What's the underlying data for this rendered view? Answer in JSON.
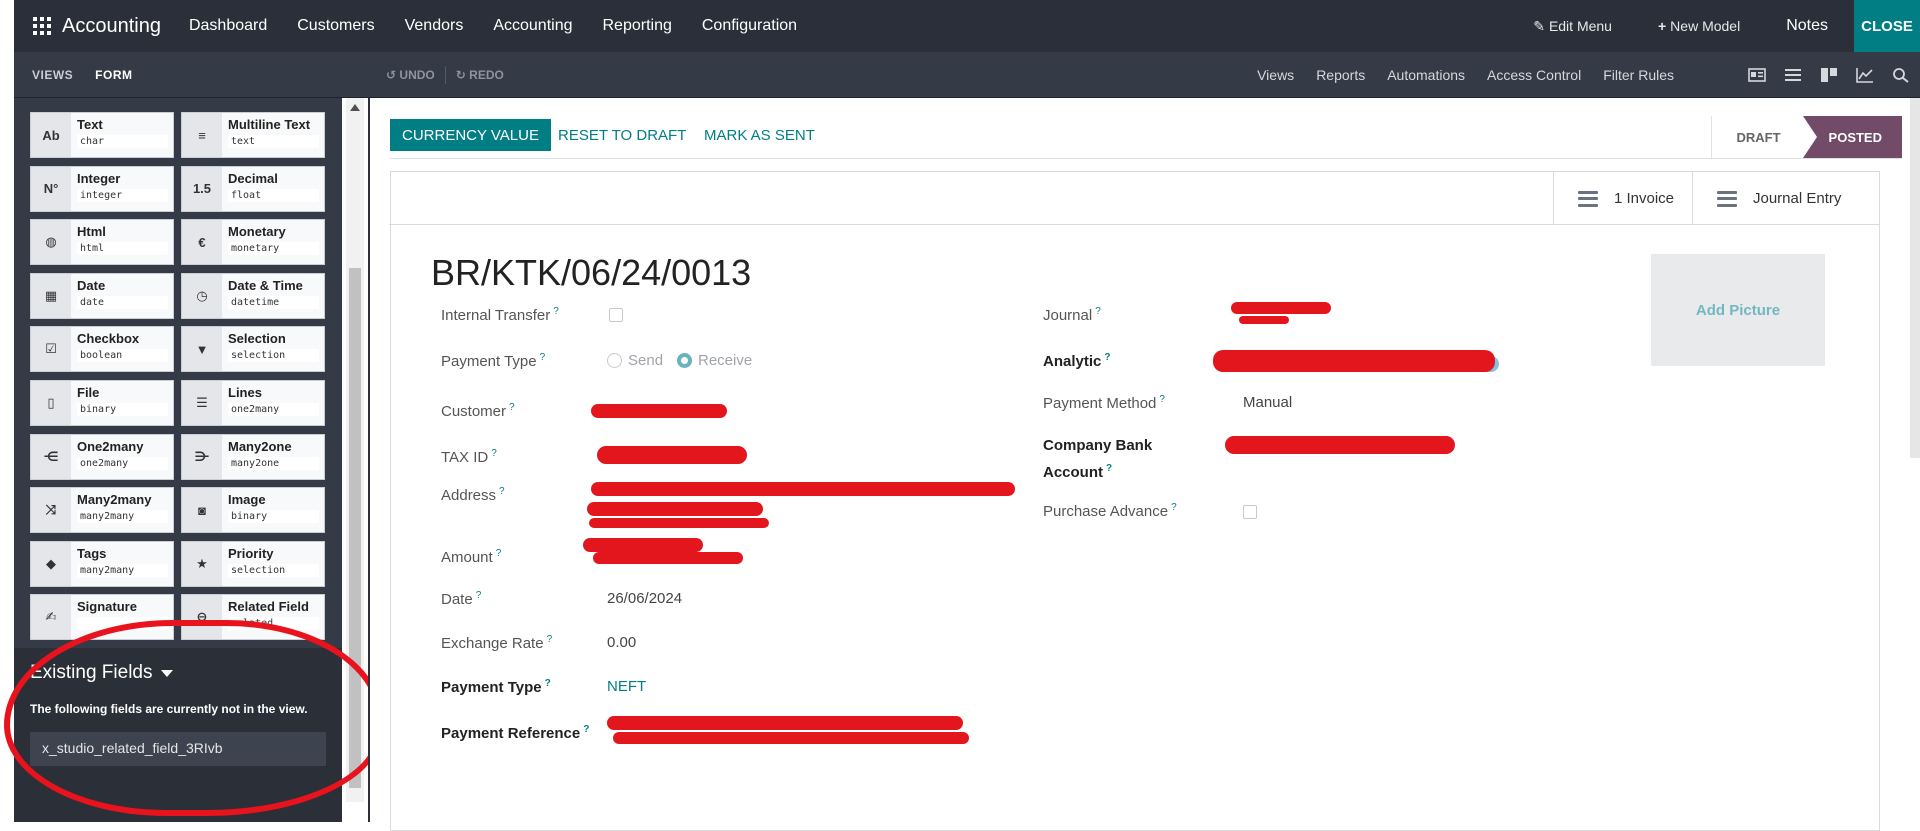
{
  "topbar": {
    "brand": "Accounting",
    "nav": [
      "Dashboard",
      "Customers",
      "Vendors",
      "Accounting",
      "Reporting",
      "Configuration"
    ],
    "edit_menu": "Edit Menu",
    "new_model": "New Model",
    "notes": "Notes",
    "close": "CLOSE"
  },
  "subbar": {
    "tabs": [
      "VIEWS",
      "FORM"
    ],
    "undo": "UNDO",
    "redo": "REDO",
    "links": [
      "Views",
      "Reports",
      "Automations",
      "Access Control",
      "Filter Rules"
    ]
  },
  "palette": [
    {
      "icon": "Ab",
      "label": "Text",
      "tech": "char"
    },
    {
      "icon": "≡",
      "label": "Multiline Text",
      "tech": "text"
    },
    {
      "icon": "N°",
      "label": "Integer",
      "tech": "integer"
    },
    {
      "icon": "1.5",
      "label": "Decimal",
      "tech": "float"
    },
    {
      "icon": "◍",
      "label": "Html",
      "tech": "html"
    },
    {
      "icon": "€",
      "label": "Monetary",
      "tech": "monetary"
    },
    {
      "icon": "▦",
      "label": "Date",
      "tech": "date"
    },
    {
      "icon": "◷",
      "label": "Date & Time",
      "tech": "datetime"
    },
    {
      "icon": "☑",
      "label": "Checkbox",
      "tech": "boolean"
    },
    {
      "icon": "▼",
      "label": "Selection",
      "tech": "selection"
    },
    {
      "icon": "▯",
      "label": "File",
      "tech": "binary"
    },
    {
      "icon": "☰",
      "label": "Lines",
      "tech": "one2many"
    },
    {
      "icon": "⋲",
      "label": "One2many",
      "tech": "one2many"
    },
    {
      "icon": "⋺",
      "label": "Many2one",
      "tech": "many2one"
    },
    {
      "icon": "⤨",
      "label": "Many2many",
      "tech": "many2many"
    },
    {
      "icon": "◙",
      "label": "Image",
      "tech": "binary"
    },
    {
      "icon": "◆",
      "label": "Tags",
      "tech": "many2many"
    },
    {
      "icon": "★",
      "label": "Priority",
      "tech": "selection"
    },
    {
      "icon": "✍",
      "label": "Signature",
      "tech": ""
    },
    {
      "icon": "⊖",
      "label": "Related Field",
      "tech": "related"
    }
  ],
  "existing": {
    "title": "Existing Fields",
    "description": "The following fields are currently not in the view.",
    "field": "x_studio_related_field_3RIvb"
  },
  "form": {
    "buttons": {
      "currency": "CURRENCY VALUE",
      "reset": "RESET TO DRAFT",
      "mark_sent": "MARK AS SENT"
    },
    "stages": [
      "DRAFT",
      "POSTED"
    ],
    "smart_buttons": [
      "1 Invoice",
      "Journal Entry"
    ],
    "title": "BR/KTK/06/24/0013",
    "add_picture": "Add Picture",
    "labels": {
      "internal_transfer": "Internal Transfer",
      "payment_type": "Payment Type",
      "customer": "Customer",
      "tax_id": "TAX ID",
      "address": "Address",
      "amount": "Amount",
      "date": "Date",
      "exchange_rate": "Exchange Rate",
      "payment_type2": "Payment Type",
      "payment_reference": "Payment Reference",
      "journal": "Journal",
      "analytic": "Analytic",
      "payment_method": "Payment Method",
      "company_bank_line1": "Company Bank",
      "company_bank_line2": "Account",
      "purchase_advance": "Purchase Advance"
    },
    "values": {
      "send": "Send",
      "receive": "Receive",
      "date": "26/06/2024",
      "exchange_rate": "0.00",
      "payment_type2": "NEFT",
      "payment_method": "Manual"
    },
    "help_mark": "?"
  }
}
